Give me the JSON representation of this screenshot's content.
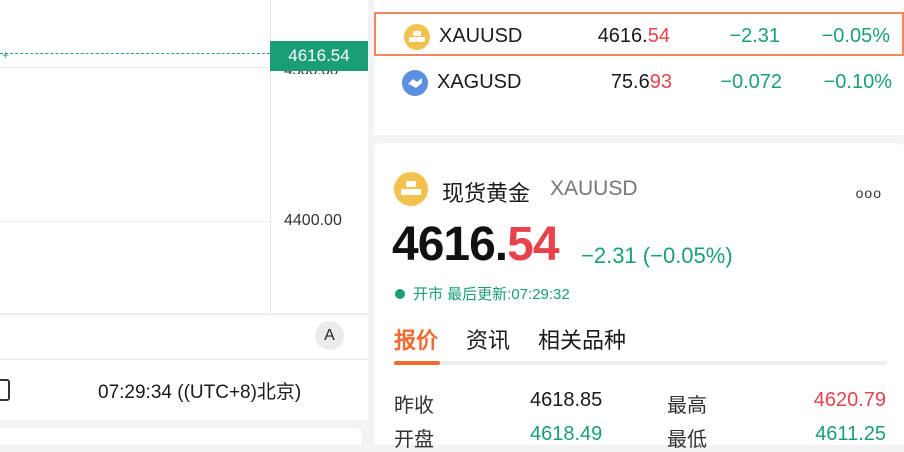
{
  "chart": {
    "price_tag": "4616.54",
    "hidden_tick": "4500.00",
    "tick_4400": "4400.00",
    "cursor_glyph": "+",
    "auto_button": "A",
    "time_text": "07:29:34 ((UTC+8)北京)"
  },
  "watchlist": [
    {
      "symbol": "XAUUSD",
      "price_main": "4616.",
      "price_hl": "54",
      "change": "−2.31",
      "pct": "−0.05%",
      "icon": "gold-bars-icon",
      "selected": true
    },
    {
      "symbol": "XAGUSD",
      "price_main": "75.6",
      "price_hl": "93",
      "change": "−0.072",
      "pct": "−0.10%",
      "icon": "silver-handshake-icon",
      "selected": false
    }
  ],
  "detail": {
    "name": "现货黄金",
    "code": "XAUUSD",
    "more": "ooo",
    "price_main": "4616.",
    "price_hl": "54",
    "change_text": "−2.31 (−0.05%)",
    "status_text": "开市 最后更新:07:29:32",
    "tabs": [
      "报价",
      "资讯",
      "相关品种"
    ],
    "stats": [
      {
        "label": "昨收",
        "value": "4618.85",
        "label2": "最高",
        "value2": "4620.79"
      },
      {
        "label": "开盘",
        "value": "4618.49",
        "label2": "最低",
        "value2": "4611.25"
      }
    ]
  },
  "colors": {
    "up_red": "#e8424d",
    "down_green": "#1a9e78",
    "accent": "#ef6b2f",
    "tag_green": "#1a9e78"
  }
}
